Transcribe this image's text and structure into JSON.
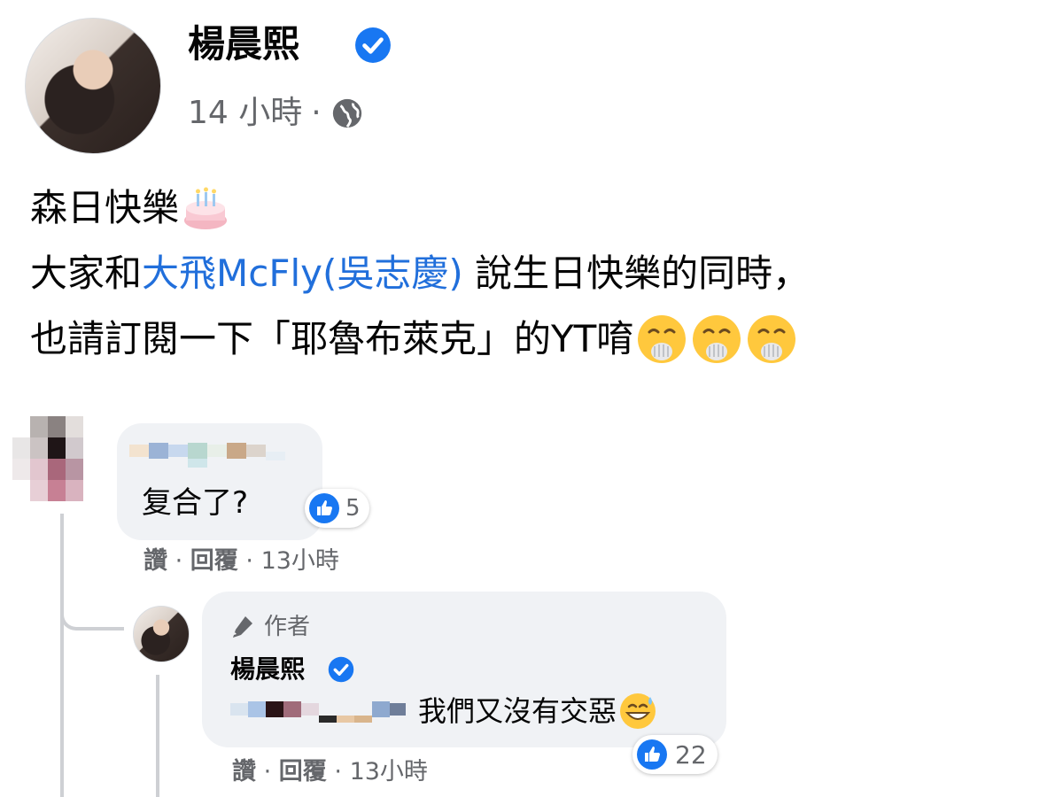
{
  "post": {
    "author": "楊晨熙",
    "time": "14 小時",
    "separator": "·",
    "privacy_icon": "globe-icon",
    "lines": {
      "line1_text": "森日快樂",
      "line1_emoji": "birthday-cake-emoji",
      "line2_prefix": "大家和",
      "line2_mention": "大飛McFly(吳志慶)",
      "line2_suffix": " 說生日快樂的同時，",
      "line3_text": "也請訂閱一下「耶魯布萊克」的YT唷",
      "line3_emojis": [
        "hand-over-mouth-emoji",
        "hand-over-mouth-emoji",
        "hand-over-mouth-emoji"
      ]
    }
  },
  "comments": [
    {
      "author_blurred": true,
      "text": "复合了?",
      "like_count": "5",
      "actions": {
        "like": "讚",
        "reply": "回覆",
        "time": "13小時",
        "sep": "·"
      }
    }
  ],
  "reply": {
    "author_badge": "作者",
    "author": "楊晨熙",
    "mention_blurred": true,
    "text": "我們又沒有交惡",
    "emoji": "grinning-sweat-emoji",
    "like_count": "22",
    "actions": {
      "like": "讚",
      "reply": "回覆",
      "time": "13小時",
      "sep": "·"
    }
  },
  "colors": {
    "link": "#216fdb",
    "verified": "#1877f2",
    "secondary_text": "#65676b",
    "bubble": "#f0f2f5"
  }
}
